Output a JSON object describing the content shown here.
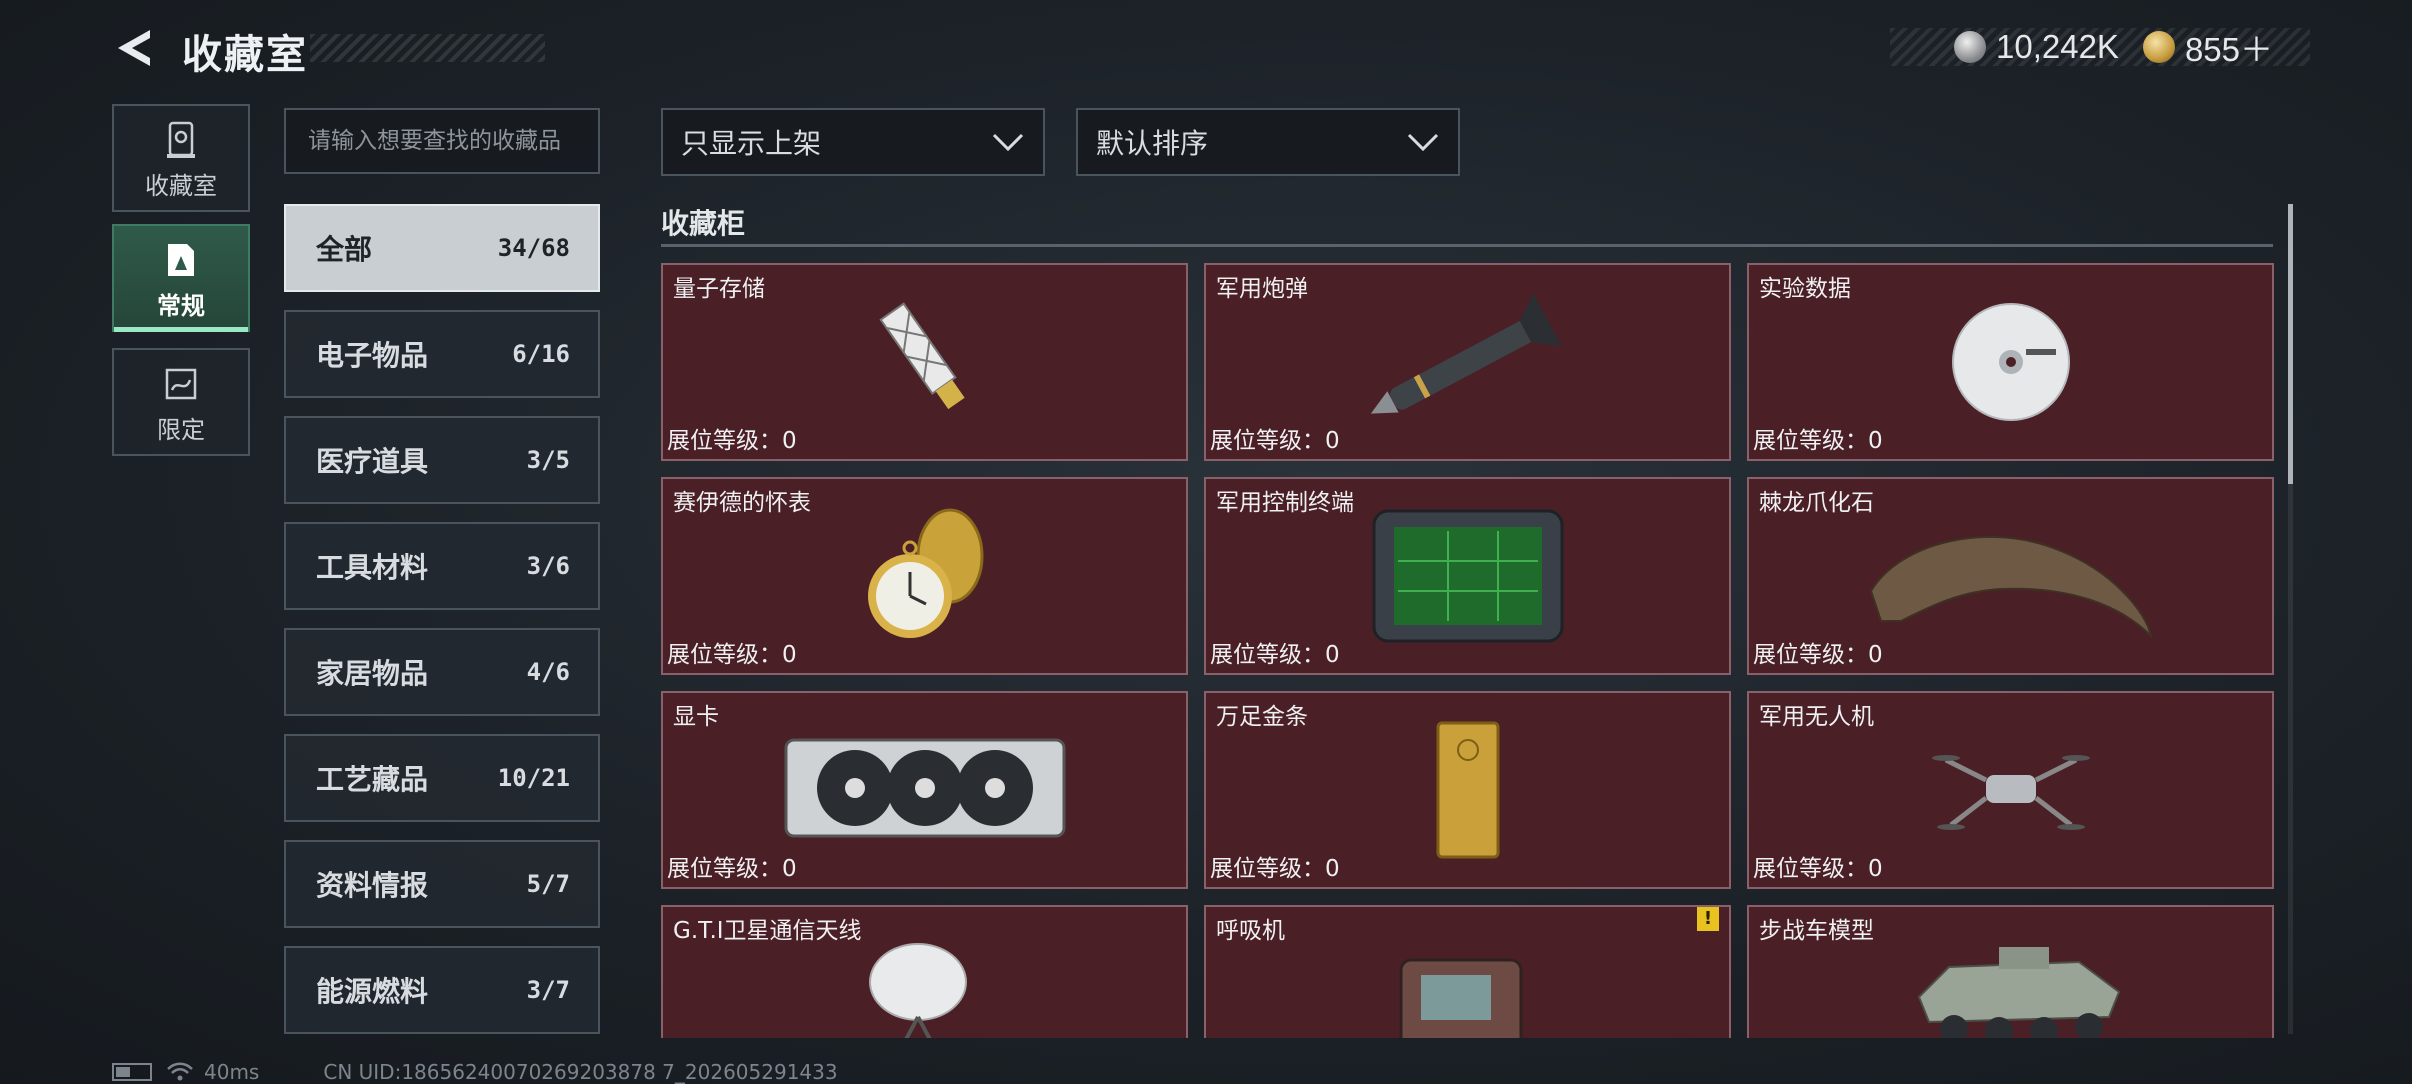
{
  "header": {
    "title": "收藏室",
    "currencies": [
      {
        "icon": "silver-coin-icon",
        "value": "10,242K"
      },
      {
        "icon": "gold-coin-icon",
        "value": "855＋"
      }
    ]
  },
  "nav": [
    {
      "label": "收藏室",
      "icon": "collection-room-icon",
      "active": false
    },
    {
      "label": "常规",
      "icon": "regular-collection-icon",
      "active": true
    },
    {
      "label": "限定",
      "icon": "limited-collection-icon",
      "active": false
    }
  ],
  "search": {
    "placeholder": "请输入想要查找的收藏品"
  },
  "categories": [
    {
      "name": "全部",
      "count": "34/68",
      "active": true
    },
    {
      "name": "电子物品",
      "count": "6/16"
    },
    {
      "name": "医疗道具",
      "count": "3/5"
    },
    {
      "name": "工具材料",
      "count": "3/6"
    },
    {
      "name": "家居物品",
      "count": "4/6"
    },
    {
      "name": "工艺藏品",
      "count": "10/21"
    },
    {
      "name": "资料情报",
      "count": "5/7"
    },
    {
      "name": "能源燃料",
      "count": "3/7"
    }
  ],
  "filters": {
    "display_filter": "只显示上架",
    "sort": "默认排序"
  },
  "section_title": "收藏柜",
  "items": [
    {
      "name": "量子存储",
      "level": "展位等级：0",
      "icon": "quantum-storage-icon"
    },
    {
      "name": "军用炮弹",
      "level": "展位等级：0",
      "icon": "military-shell-icon"
    },
    {
      "name": "实验数据",
      "level": "展位等级：0",
      "icon": "data-disc-icon"
    },
    {
      "name": "赛伊德的怀表",
      "level": "展位等级：0",
      "icon": "pocket-watch-icon"
    },
    {
      "name": "军用控制终端",
      "level": "展位等级：0",
      "icon": "control-terminal-icon"
    },
    {
      "name": "棘龙爪化石",
      "level": "展位等级：0",
      "icon": "claw-fossil-icon"
    },
    {
      "name": "显卡",
      "level": "展位等级：0",
      "icon": "graphics-card-icon"
    },
    {
      "name": "万足金条",
      "level": "展位等级：0",
      "icon": "gold-bar-icon"
    },
    {
      "name": "军用无人机",
      "level": "展位等级：0",
      "icon": "drone-icon"
    },
    {
      "name": "G.T.I卫星通信天线",
      "level": "",
      "icon": "satellite-dish-icon"
    },
    {
      "name": "呼吸机",
      "level": "",
      "icon": "ventilator-icon",
      "badge": "!"
    },
    {
      "name": "步战车模型",
      "level": "",
      "icon": "ifv-model-icon"
    }
  ],
  "footer": {
    "ping": "40ms",
    "uid": "CN UID:18656240070269203878 7_202605291433"
  },
  "colors": {
    "card_bg": "#4b1f26",
    "card_border": "#8a6168",
    "active_nav": "#2f5a4a",
    "accent": "#9be8c4",
    "badge": "#e8c21f"
  }
}
